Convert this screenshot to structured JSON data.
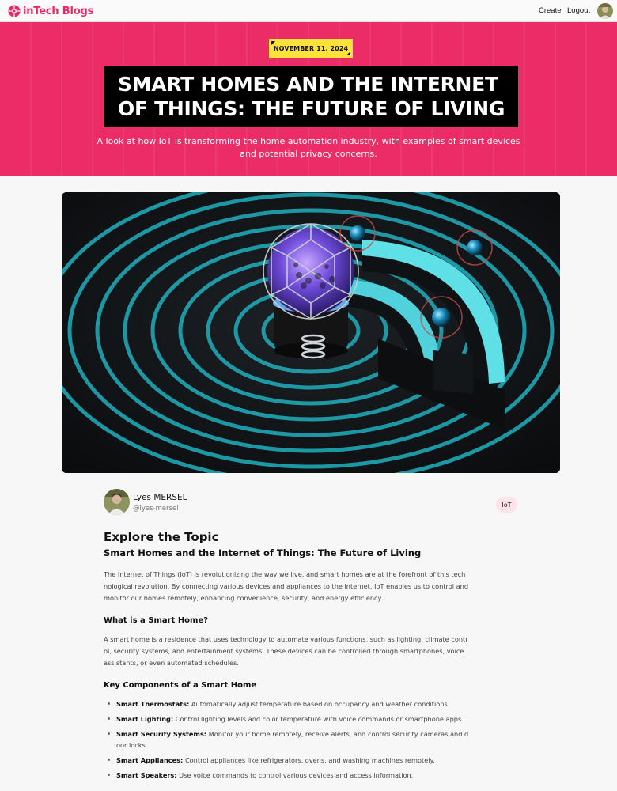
{
  "nav": {
    "logo_text": "inTech Blogs",
    "create_label": "Create",
    "logout_label": "Logout"
  },
  "hero": {
    "date": "NOVEMBER 11, 2024",
    "title": "SMART HOMES AND THE INTERNET OF THINGS: THE FUTURE OF LIVING",
    "subtitle": "A look at how IoT is transforming the home automation industry, with examples of smart devices and potential privacy concerns."
  },
  "author": {
    "name": "Lyes MERSEL",
    "handle": "@lyes-mersel",
    "tag": "IoT"
  },
  "article": {
    "topic_heading": "Explore the Topic",
    "title": "Smart Homes and the Internet of Things: The Future of Living",
    "intro": "The Internet of Things (IoT) is revolutionizing the way we live, and smart homes are at the forefront of this technological revolution. By connecting various devices and appliances to the internet, IoT enables us to control and monitor our homes remotely, enhancing convenience, security, and energy efficiency.",
    "section1_heading": "What is a Smart Home?",
    "section1_text": "A smart home is a residence that uses technology to automate various functions, such as lighting, climate control, security systems, and entertainment systems. These devices can be controlled through smartphones, voice assistants, or even automated schedules.",
    "section2_heading": "Key Components of a Smart Home",
    "components": [
      {
        "name": "Smart Thermostats:",
        "text": "Automatically adjust temperature based on occupancy and weather conditions."
      },
      {
        "name": "Smart Lighting:",
        "text": "Control lighting levels and color temperature with voice commands or smartphone apps."
      },
      {
        "name": "Smart Security Systems:",
        "text": "Monitor your home remotely, receive alerts, and control security cameras and door locks."
      },
      {
        "name": "Smart Appliances:",
        "text": "Control appliances like refrigerators, ovens, and washing machines remotely."
      },
      {
        "name": "Smart Speakers:",
        "text": "Use voice commands to control various devices and access information."
      }
    ]
  },
  "colors": {
    "brand_pink": "#ec2c67",
    "badge_yellow": "#fde23b",
    "title_bg": "#000000",
    "tag_bg": "#fde4ea"
  },
  "icons": {
    "logo": "pink-circuit-logo-icon",
    "user_avatar": "user-avatar",
    "author_avatar": "author-avatar"
  }
}
